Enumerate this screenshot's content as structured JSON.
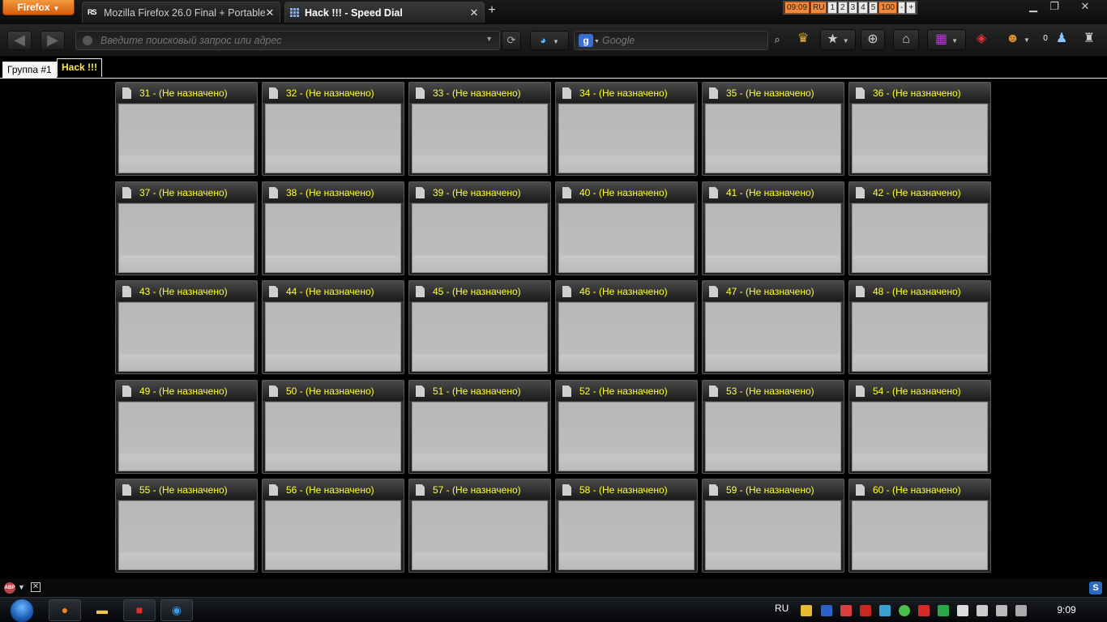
{
  "titlebar": {
    "firefox_button": "Firefox",
    "tabs": [
      {
        "title": "Mozilla Firefox 26.0 Final + Portable...",
        "favicon": "rs-icon",
        "active": false
      },
      {
        "title": "Hack !!! - Speed Dial",
        "favicon": "speed-dial-grid-icon",
        "active": true
      }
    ],
    "new_tab_label": "+",
    "tab_group_buttons": [
      "09:09",
      "RU",
      "1",
      "2",
      "3",
      "4",
      "5",
      "100",
      "-",
      "+"
    ],
    "window_controls": [
      "minimize-icon",
      "restore-icon",
      "close-icon"
    ]
  },
  "navbar": {
    "url_placeholder": "Введите поисковый запрос или адрес",
    "search_placeholder": "Google",
    "search_engine_letter": "g",
    "counter": "0"
  },
  "speed_dial": {
    "groups": [
      {
        "label": "Группа #1",
        "active": false
      },
      {
        "label": "Hack !!!",
        "active": true
      }
    ],
    "dials": [
      "31 - (Не назначено)",
      "32 - (Не назначено)",
      "33 - (Не назначено)",
      "34 - (Не назначено)",
      "35 - (Не назначено)",
      "36 - (Не назначено)",
      "37 - (Не назначено)",
      "38 - (Не назначено)",
      "39 - (Не назначено)",
      "40 - (Не назначено)",
      "41 - (Не назначено)",
      "42 - (Не назначено)",
      "43 - (Не назначено)",
      "44 - (Не назначено)",
      "45 - (Не назначено)",
      "46 - (Не назначено)",
      "47 - (Не назначено)",
      "48 - (Не назначено)",
      "49 - (Не назначено)",
      "50 - (Не назначено)",
      "51 - (Не назначено)",
      "52 - (Не назначено)",
      "53 - (Не назначено)",
      "54 - (Не назначено)",
      "55 - (Не назначено)",
      "56 - (Не назначено)",
      "57 - (Не назначено)",
      "58 - (Не назначено)",
      "59 - (Не назначено)",
      "60 - (Не назначено)"
    ]
  },
  "addonbar": {
    "abp_label": "ABP",
    "s_label": "S"
  },
  "taskbar": {
    "language": "RU",
    "clock": "9:09"
  }
}
